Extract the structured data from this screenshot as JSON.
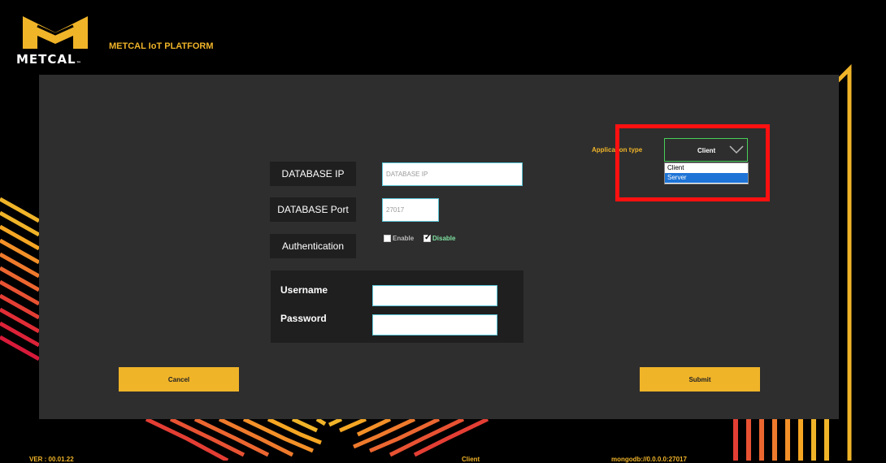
{
  "brand": {
    "logo_text": "METCAL",
    "logo_tm": "™",
    "platform_title": "METCAL IoT PLATFORM"
  },
  "form": {
    "db_ip_label": "DATABASE IP",
    "db_ip_value": "",
    "db_ip_placeholder": "DATABASE IP",
    "db_port_label": "DATABASE Port",
    "db_port_value": "27017",
    "auth_label": "Authentication",
    "auth_options": [
      {
        "label": "Enable",
        "checked": false
      },
      {
        "label": "Disable",
        "checked": true
      }
    ],
    "username_label": "Username",
    "username_value": "",
    "password_label": "Password",
    "password_value": ""
  },
  "app_type": {
    "label": "Application type",
    "selected": "Client",
    "options": [
      "Client",
      "Server"
    ],
    "highlighted": "Server"
  },
  "buttons": {
    "cancel": "Cancel",
    "submit": "Submit"
  },
  "footer": {
    "version": "VER : 00.01.22",
    "mode": "Client",
    "connection": "mongodb://0.0.0.0:27017"
  },
  "colors": {
    "accent": "#f0b429",
    "panel": "#2e2e2e",
    "highlight": "#ff1010",
    "select_border": "#48d05a",
    "input_border": "#5cc6d8",
    "disable_text": "#7fe0a0"
  }
}
